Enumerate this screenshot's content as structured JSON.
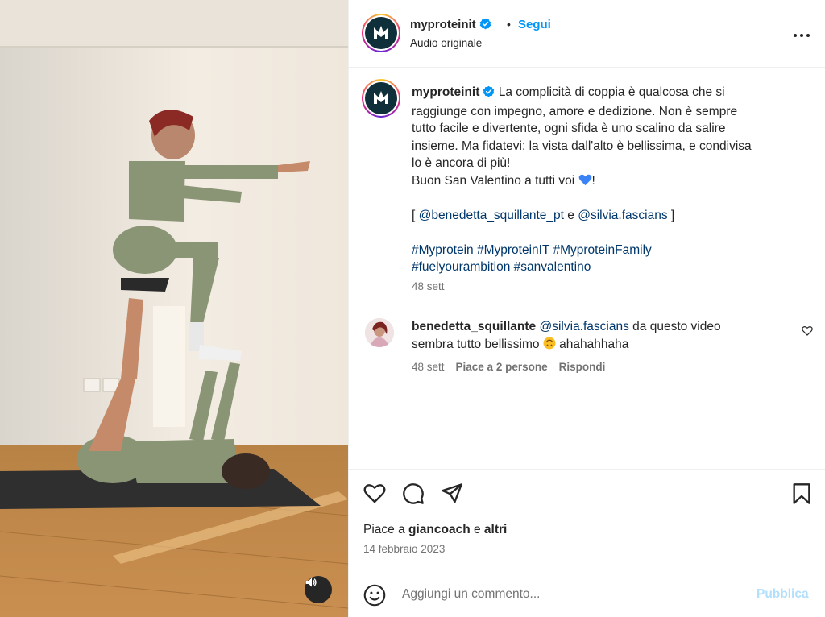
{
  "header": {
    "username": "myproteinit",
    "dot": "•",
    "follow_label": "Segui",
    "subtitle": "Audio originale"
  },
  "caption": {
    "username": "myproteinit",
    "lines": [
      "La complicità di coppia è qualcosa che si",
      "raggiunge con impegno, amore e dedizione. Non è sempre",
      "tutto facile e divertente, ogni sfida è uno scalino da salire",
      "insieme. Ma fidatevi: la vista dall'alto è bellissima, e condivisa",
      "lo è ancora di più!"
    ],
    "valentine_text": "Buon San Valentino a tutti voi ",
    "valentine_end": "!",
    "mentions_open": "[ ",
    "mention_1": "@benedetta_squillante_pt",
    "mentions_and": " e ",
    "mention_2": "@silvia.fascians",
    "mentions_close": " ]",
    "hashtags_line1": "#Myprotein #MyproteinIT #MyproteinFamily",
    "hashtags_line2": "#fuelyourambition #sanvalentino",
    "time": "48 sett"
  },
  "comment": {
    "username": "benedetta_squillante",
    "mention": "@silvia.fascians",
    "text_part1": " da questo video",
    "text_part2": "sembra tutto bellissimo ",
    "text_part3": " ahahahhaha",
    "time": "48 sett",
    "likes_label": "Piace a 2 persone",
    "reply_label": "Rispondi"
  },
  "actions": {
    "likes_prefix": "Piace a ",
    "likes_user": "giancoach",
    "likes_mid": " e ",
    "likes_others": "altri",
    "date": "14 febbraio 2023"
  },
  "add_comment": {
    "placeholder": "Aggiungi un commento...",
    "publish_label": "Pubblica"
  },
  "icons": {
    "verified": "verified-badge-icon",
    "more": "more-options-icon",
    "like": "heart-icon",
    "comment": "comment-icon",
    "share": "share-icon",
    "save": "bookmark-icon",
    "emoji": "emoji-icon",
    "sound": "speaker-icon"
  },
  "colors": {
    "accent": "#0095f6",
    "link": "#00376b",
    "secondary_text": "#737373",
    "publish_disabled": "#b2dffc"
  }
}
